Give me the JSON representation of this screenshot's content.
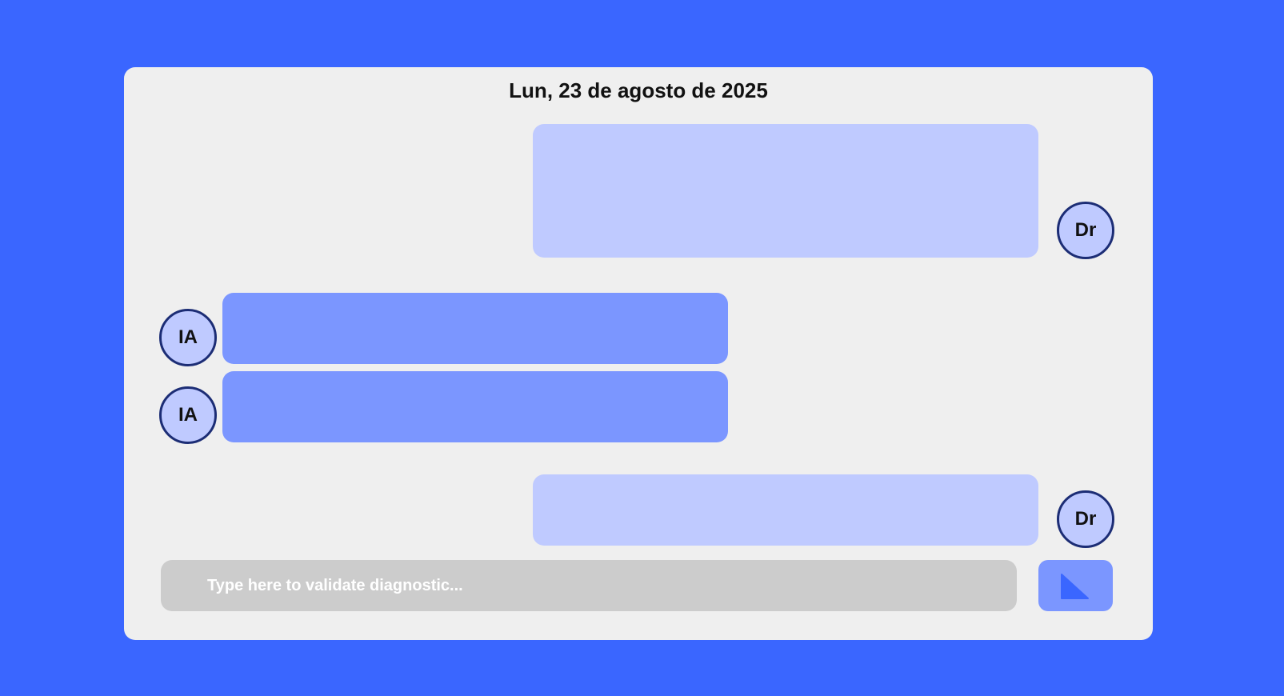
{
  "header": {
    "date": "Lun, 23 de agosto de 2025"
  },
  "messages": [
    {
      "sender": "Dr",
      "text": ""
    },
    {
      "sender": "IA",
      "text": ""
    },
    {
      "sender": "IA",
      "text": ""
    },
    {
      "sender": "Dr",
      "text": ""
    }
  ],
  "composer": {
    "placeholder": "Type here to validate diagnostic...",
    "value": "",
    "send_icon": "send-triangle-icon"
  },
  "colors": {
    "background": "#3a66ff",
    "card": "#efefef",
    "doctor_bubble": "#bfcaff",
    "ai_bubble": "#7b96ff",
    "avatar_border": "#1c2d75",
    "input": "#cccccc",
    "send_icon": "#3a66ff"
  }
}
